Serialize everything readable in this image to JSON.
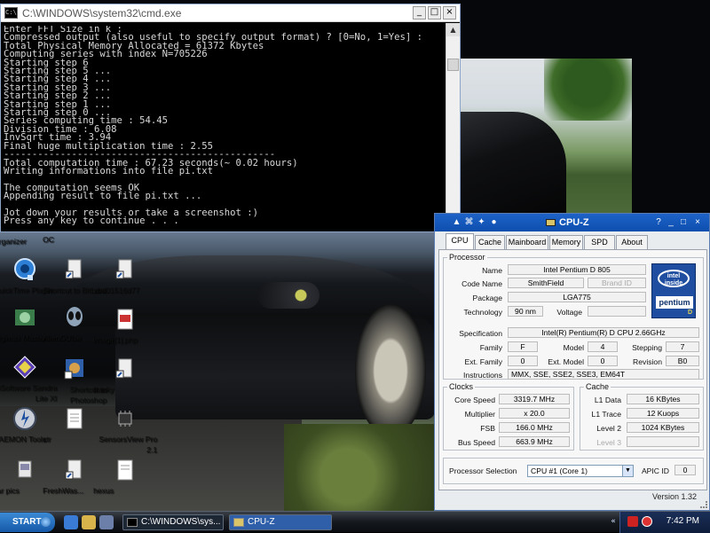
{
  "console": {
    "title": "C:\\WINDOWS\\system32\\cmd.exe",
    "icon_text": "C:\\",
    "lines": [
      "Enter FFT Size in k :",
      "Compressed output (also useful to specify output format) ? [0=No, 1=Yes] :",
      "Total Physical Memory Allocated = 61372 Kbytes",
      "Computing series with index N=705226",
      "Starting step 6",
      "Starting step 5 ...",
      "Starting step 4 ...",
      "Starting step 3 ...",
      "Starting step 2 ...",
      "Starting step 1 ...",
      "Starting step 0 ...",
      "Series computing time : 54.45",
      "Division time : 6.08",
      "InvSqrt time : 3.94",
      "Final huge multiplication time : 2.55",
      "------------------------------------------------",
      "Total computation time : 67.23 seconds(~ 0.02 hours)",
      "Writing informations into file pi.txt",
      "",
      "The computation seems OK",
      "Appending result to file pi.txt ...",
      "",
      "Jot down your results or take a screenshot :)",
      "Press any key to continue . . ."
    ]
  },
  "desktop": {
    "icons": [
      {
        "label": "Organizer"
      },
      {
        "label": "QuickTime Player"
      },
      {
        "label": "Digimax Master"
      },
      {
        "label": "SiSoftware Sandra Lite XI"
      },
      {
        "label": "DAEMON Tools"
      },
      {
        "label": "car pics"
      },
      {
        "label": "OC"
      },
      {
        "label": "Shortcut to BitLord"
      },
      {
        "label": "AlienGUIse"
      },
      {
        "label": "Shortcut to Photoshop"
      },
      {
        "label": "ctr"
      },
      {
        "label": "FreshWas..."
      },
      {
        "label": "vba01516d77"
      },
      {
        "label": "image[1].php"
      },
      {
        "label": "franky"
      },
      {
        "label": "SensorsView Pro 2.1"
      },
      {
        "label": "hexus"
      }
    ]
  },
  "cpuz": {
    "title": "CPU-Z",
    "tabs": [
      "CPU",
      "Cache",
      "Mainboard",
      "Memory",
      "SPD",
      "About"
    ],
    "active_tab": "CPU",
    "processor": {
      "group_title": "Processor",
      "name_label": "Name",
      "name": "Intel Pentium D 805",
      "code_name_label": "Code Name",
      "code_name": "SmithField",
      "brand_id_label": "Brand ID",
      "package_label": "Package",
      "package": "LGA775",
      "technology_label": "Technology",
      "technology": "90 nm",
      "voltage_label": "Voltage",
      "spec_label": "Specification",
      "specification": "Intel(R) Pentium(R) D  CPU 2.66GHz",
      "family_label": "Family",
      "family": "F",
      "model_label": "Model",
      "model": "4",
      "stepping_label": "Stepping",
      "stepping": "7",
      "ext_family_label": "Ext. Family",
      "ext_family": "0",
      "ext_model_label": "Ext. Model",
      "ext_model": "0",
      "revision_label": "Revision",
      "revision": "B0",
      "instructions_label": "Instructions",
      "instructions": "MMX, SSE, SSE2, SSE3, EM64T"
    },
    "logo": {
      "inside": "intel inside",
      "brand": "pentium",
      "sub": "D"
    },
    "clocks": {
      "group_title": "Clocks",
      "core_speed_label": "Core Speed",
      "core_speed": "3319.7 MHz",
      "multiplier_label": "Multiplier",
      "multiplier": "x 20.0",
      "fsb_label": "FSB",
      "fsb": "166.0 MHz",
      "bus_speed_label": "Bus Speed",
      "bus_speed": "663.9 MHz"
    },
    "cache": {
      "group_title": "Cache",
      "l1_data_label": "L1 Data",
      "l1_data": "16 KBytes",
      "l1_trace_label": "L1 Trace",
      "l1_trace": "12 Kuops",
      "level2_label": "Level 2",
      "level2": "1024 KBytes",
      "level3_label": "Level 3"
    },
    "selection": {
      "label": "Processor Selection",
      "value": "CPU #1 (Core 1)",
      "apic_label": "APIC ID",
      "apic": "0"
    },
    "version": "Version 1.32"
  },
  "taskbar": {
    "start_label": "START",
    "tasks": [
      {
        "label": "C:\\WINDOWS\\sys..."
      },
      {
        "label": "CPU-Z"
      }
    ],
    "clock": "7:42 PM"
  }
}
